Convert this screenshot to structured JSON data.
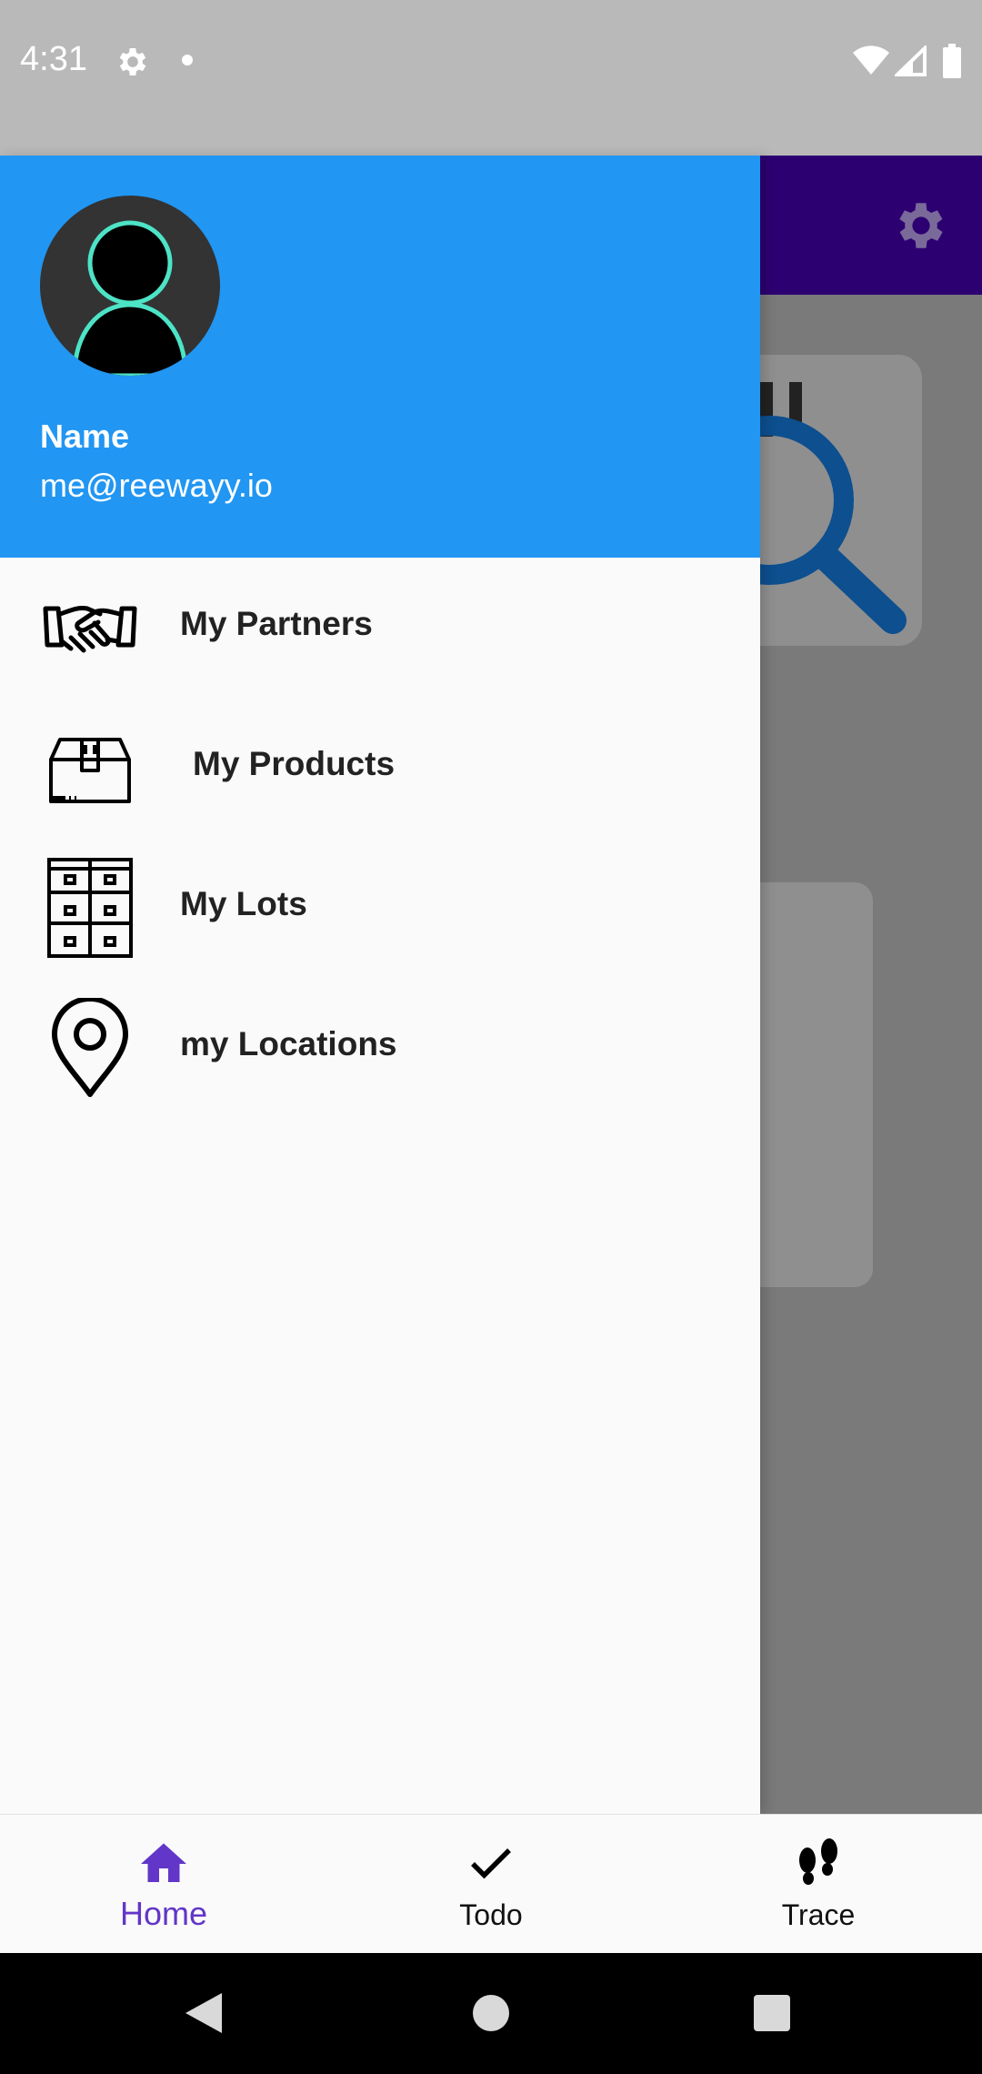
{
  "status_bar": {
    "time": "4:31",
    "icons": [
      "gear-icon",
      "dot-icon",
      "wifi-icon",
      "cellular-icon",
      "battery-icon"
    ]
  },
  "colors": {
    "drawer_header": "#2196f3",
    "app_topbar": "#2d0072",
    "accent": "#6236c8",
    "avatar_ring": "#4de3c6"
  },
  "drawer": {
    "profile": {
      "name": "Name",
      "email": "me@reewayy.io"
    },
    "items": [
      {
        "label": "My Partners",
        "icon": "handshake-icon"
      },
      {
        "label": "My Products",
        "icon": "box-icon"
      },
      {
        "label": "My Lots",
        "icon": "stacked-boxes-icon"
      },
      {
        "label": "my Locations",
        "icon": "location-pin-icon"
      }
    ]
  },
  "bottom_nav": {
    "items": [
      {
        "label": "Home",
        "icon": "home-icon",
        "active": true
      },
      {
        "label": "Todo",
        "icon": "check-icon",
        "active": false
      },
      {
        "label": "Trace",
        "icon": "footprints-icon",
        "active": false
      }
    ]
  }
}
